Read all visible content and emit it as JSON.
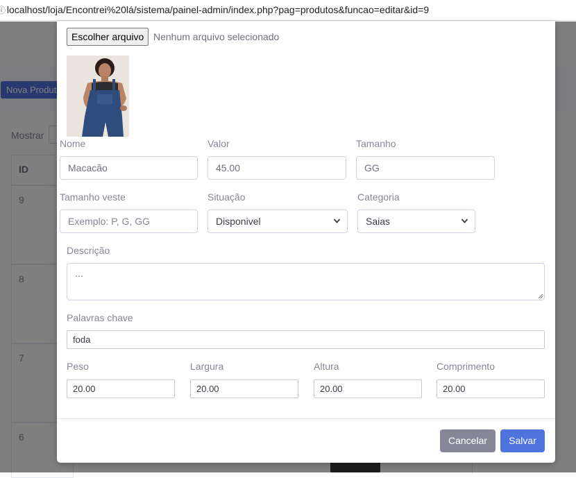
{
  "browser": {
    "url": "localhost/loja/Encontrei%20lá/sistema/painel-admin/index.php?pag=produtos&funcao=editar&id=9"
  },
  "background": {
    "new_button_label": "Nova Produto",
    "show_label": "Mostrar",
    "table_header_id": "ID",
    "row_ids": [
      "9",
      "8",
      "7",
      "6"
    ]
  },
  "modal": {
    "file": {
      "button_label": "Escolher arquivo",
      "status": "Nenhum arquivo selecionado"
    },
    "fields": {
      "nome": {
        "label": "Nome",
        "value": "Macacão"
      },
      "valor": {
        "label": "Valor",
        "value": "45.00"
      },
      "tamanho": {
        "label": "Tamanho",
        "value": "GG"
      },
      "tamanho_veste": {
        "label": "Tamanho veste",
        "placeholder": "Exemplo: P, G, GG"
      },
      "situacao": {
        "label": "Situação",
        "value": "Disponivel"
      },
      "categoria": {
        "label": "Categoria",
        "value": "Saias"
      },
      "descricao": {
        "label": "Descrição",
        "value": "..."
      },
      "palavras": {
        "label": "Palavras chave",
        "value": "foda"
      },
      "peso": {
        "label": "Peso",
        "value": "20.00"
      },
      "largura": {
        "label": "Largura",
        "value": "20.00"
      },
      "altura": {
        "label": "Altura",
        "value": "20.00"
      },
      "comprimento": {
        "label": "Comprimento",
        "value": "20.00"
      }
    },
    "buttons": {
      "cancel": "Cancelar",
      "save": "Salvar"
    }
  },
  "colors": {
    "primary": "#4e73df",
    "secondary": "#858796",
    "overlay": "rgba(0,0,0,0.5)"
  }
}
